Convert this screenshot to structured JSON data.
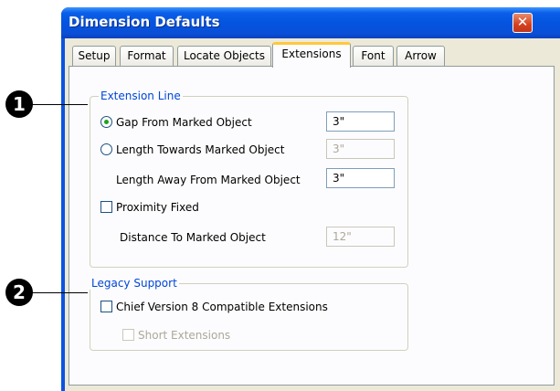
{
  "window": {
    "title": "Dimension Defaults",
    "close_glyph": "✕"
  },
  "tabs": [
    {
      "label": "Setup",
      "active": false
    },
    {
      "label": "Format",
      "active": false
    },
    {
      "label": "Locate Objects",
      "active": false
    },
    {
      "label": "Extensions",
      "active": true
    },
    {
      "label": "Font",
      "active": false
    },
    {
      "label": "Arrow",
      "active": false
    }
  ],
  "extension_line": {
    "title": "Extension Line",
    "gap_label": "Gap From Marked Object",
    "gap_value": "3\"",
    "gap_selected": true,
    "length_towards_label": "Length Towards Marked Object",
    "length_towards_value": "3\"",
    "length_towards_selected": false,
    "length_away_label": "Length Away From Marked Object",
    "length_away_value": "3\"",
    "proximity_label": "Proximity Fixed",
    "proximity_checked": false,
    "distance_label": "Distance To Marked Object",
    "distance_value": "12\""
  },
  "legacy_support": {
    "title": "Legacy Support",
    "chief_v8_label": "Chief Version 8 Compatible Extensions",
    "chief_v8_checked": false,
    "short_ext_label": "Short Extensions",
    "short_ext_checked": false
  },
  "callouts": [
    "1",
    "2"
  ],
  "colors": {
    "titlebar": "#0454e0",
    "dialog_bg": "#ece9d8",
    "group_title": "#0046d5",
    "active_tab_highlight": "#ffc83c"
  }
}
